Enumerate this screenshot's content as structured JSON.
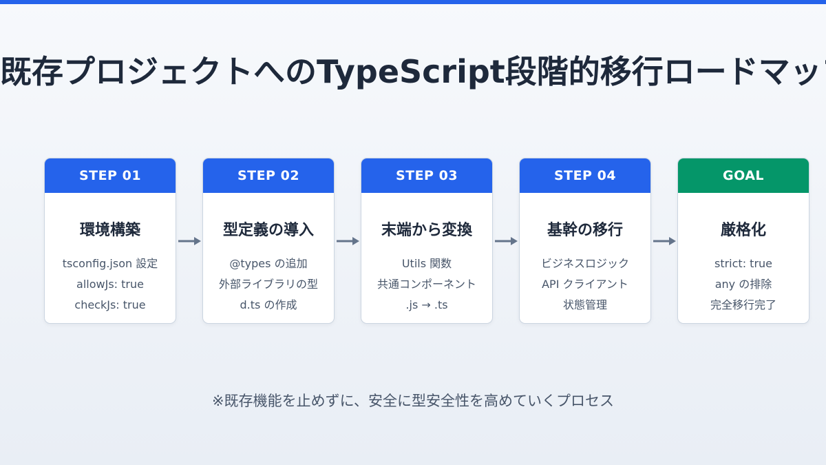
{
  "title": "既存プロジェクトへのTypeScript段階的移行ロードマップ",
  "colors": {
    "accent": "#2563eb",
    "goal": "#059669",
    "text": "#1e293b",
    "muted": "#475569",
    "arrow": "#64748b"
  },
  "steps": [
    {
      "label": "STEP 01",
      "title": "環境構築",
      "items": [
        "tsconfig.json 設定",
        "allowJs: true",
        "checkJs: true"
      ]
    },
    {
      "label": "STEP 02",
      "title": "型定義の導入",
      "items": [
        "@types の追加",
        "外部ライブラリの型",
        "d.ts の作成"
      ]
    },
    {
      "label": "STEP 03",
      "title": "末端から変換",
      "items": [
        "Utils 関数",
        "共通コンポーネント",
        ".js → .ts"
      ]
    },
    {
      "label": "STEP 04",
      "title": "基幹の移行",
      "items": [
        "ビジネスロジック",
        "API クライアント",
        "状態管理"
      ]
    },
    {
      "label": "GOAL",
      "title": "厳格化",
      "items": [
        "strict: true",
        "any の排除",
        "完全移行完了"
      ]
    }
  ],
  "footnote": "※既存機能を止めずに、安全に型安全性を高めていくプロセス"
}
